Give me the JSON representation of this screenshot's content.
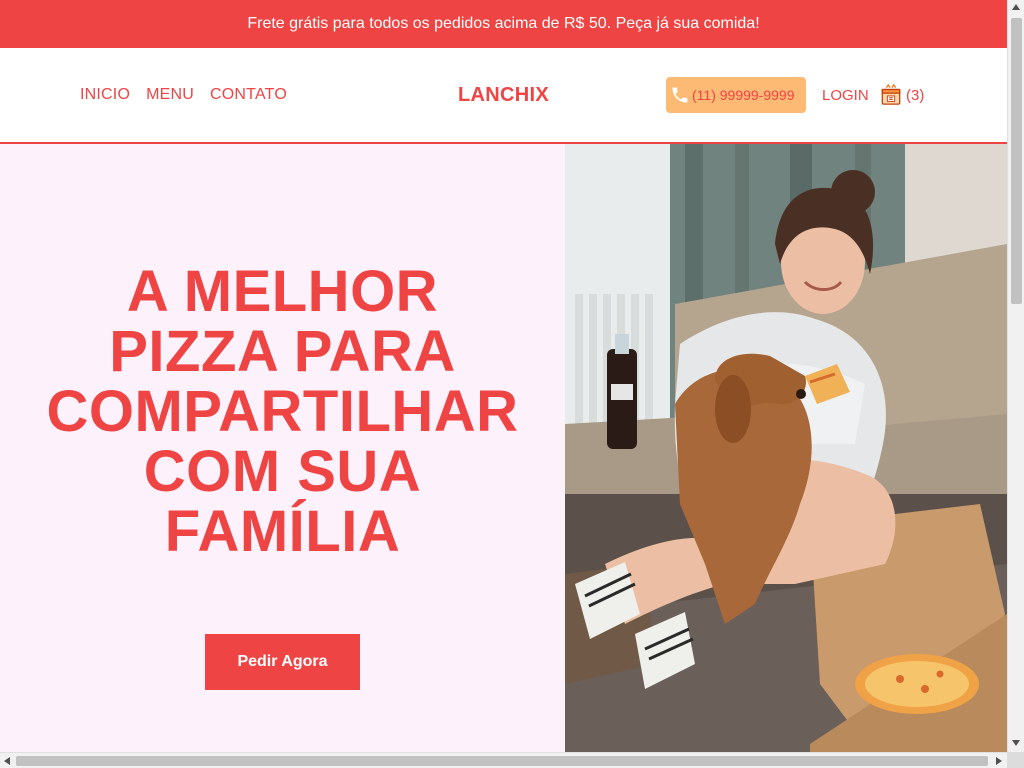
{
  "promo": {
    "text": "Frete grátis para todos os pedidos acima de R$ 50. Peça já sua comida!"
  },
  "nav": {
    "items": [
      {
        "label": "INICIO"
      },
      {
        "label": "MENU"
      },
      {
        "label": "CONTATO"
      }
    ]
  },
  "brand": {
    "logo_text": "LANCHIX"
  },
  "header": {
    "phone": {
      "icon": "phone-icon",
      "text": "(11) 99999-9999"
    },
    "login_label": "LOGIN",
    "cart": {
      "icon": "cart-icon",
      "count_label": "(3)"
    }
  },
  "hero": {
    "title_lines": [
      "A MELHOR",
      "PIZZA PARA",
      "COMPARTILHAR",
      "COM SUA",
      "FAMÍLIA"
    ],
    "cta_label": "Pedir Agora"
  },
  "colors": {
    "accent": "#ef4444",
    "hero_bg": "#fdf2fb",
    "phone_bg": "#fdba74",
    "promo_text": "#ffffff"
  }
}
